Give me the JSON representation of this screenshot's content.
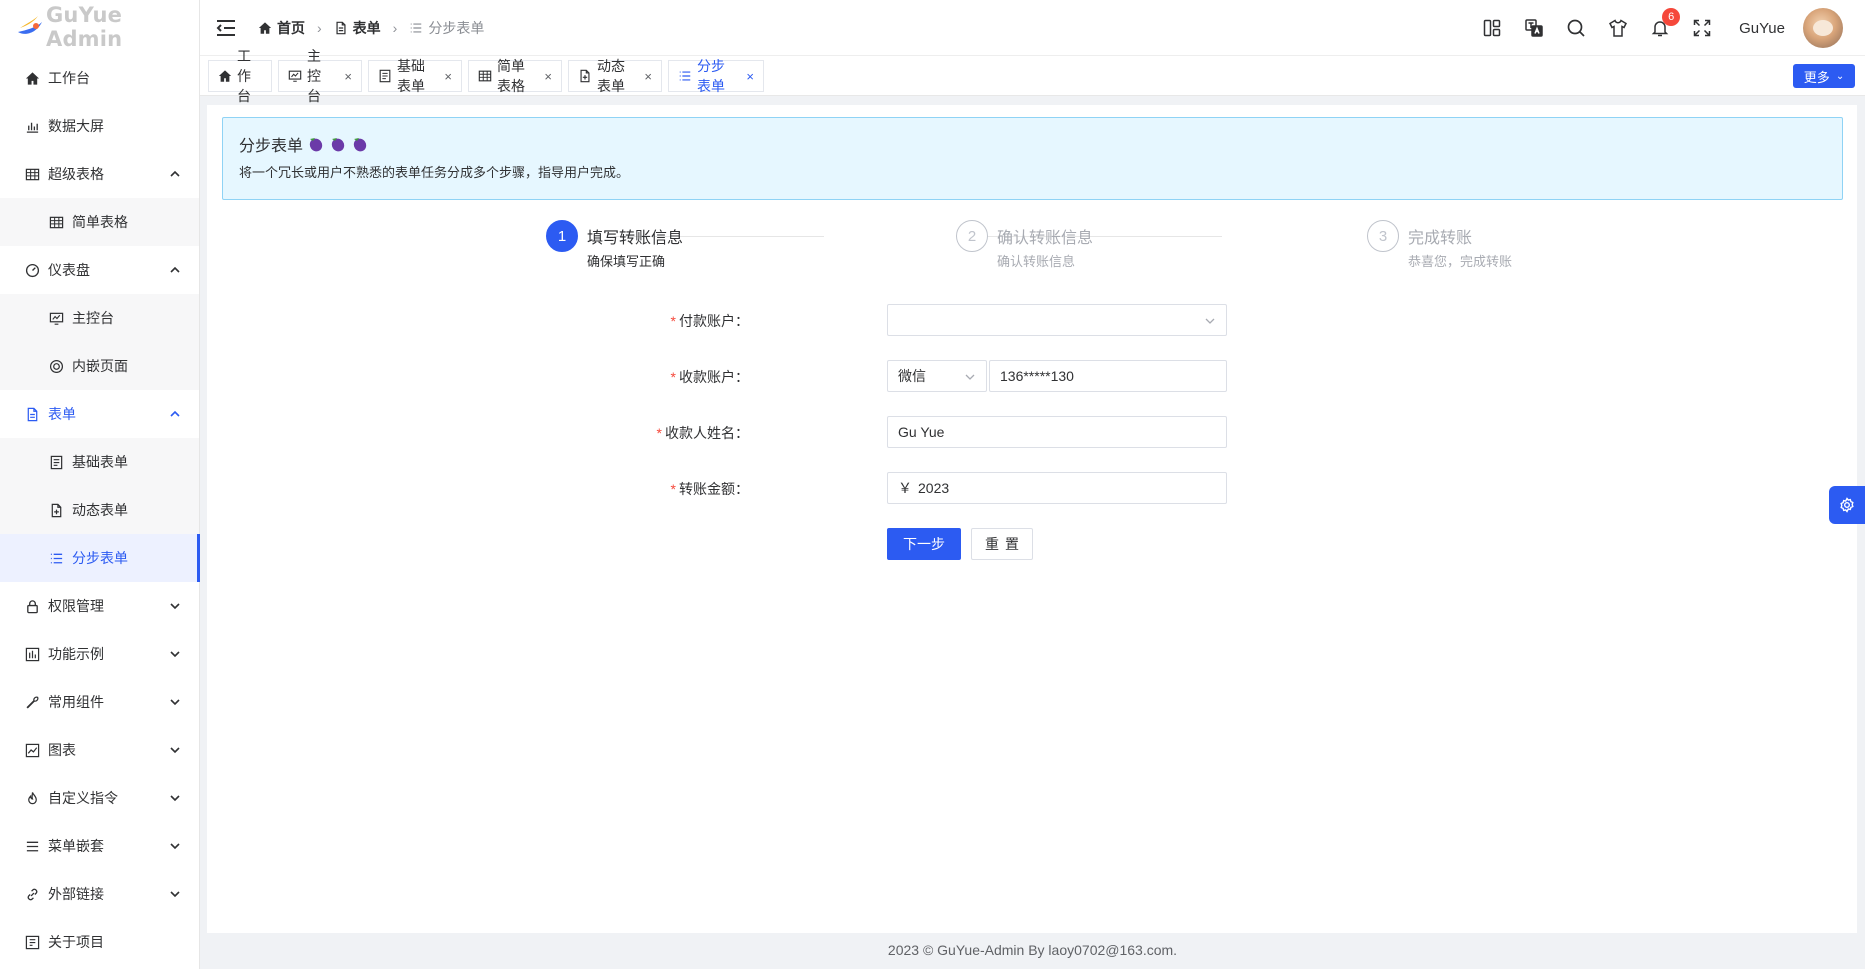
{
  "app": {
    "name": "GuYue Admin"
  },
  "sidebar": {
    "items": [
      {
        "label": "工作台",
        "icon": "home-icon",
        "level": 1
      },
      {
        "label": "数据大屏",
        "icon": "bar-chart-icon",
        "level": 1
      },
      {
        "label": "超级表格",
        "icon": "grid-icon",
        "level": 1,
        "expanded": true
      },
      {
        "label": "简单表格",
        "icon": "grid-icon",
        "level": 2
      },
      {
        "label": "仪表盘",
        "icon": "speedometer-icon",
        "level": 1,
        "expanded": true
      },
      {
        "label": "主控台",
        "icon": "monitor-icon",
        "level": 2
      },
      {
        "label": "内嵌页面",
        "icon": "target-icon",
        "level": 2
      },
      {
        "label": "表单",
        "icon": "document-icon",
        "level": 1,
        "expanded": true,
        "active": true
      },
      {
        "label": "基础表单",
        "icon": "form-icon",
        "level": 2
      },
      {
        "label": "动态表单",
        "icon": "document-plus-icon",
        "level": 2
      },
      {
        "label": "分步表单",
        "icon": "list-icon",
        "level": 2,
        "active": true
      },
      {
        "label": "权限管理",
        "icon": "lock-icon",
        "level": 1
      },
      {
        "label": "功能示例",
        "icon": "function-icon",
        "level": 1
      },
      {
        "label": "常用组件",
        "icon": "tool-icon",
        "level": 1
      },
      {
        "label": "图表",
        "icon": "line-chart-icon",
        "level": 1
      },
      {
        "label": "自定义指令",
        "icon": "fire-icon",
        "level": 1
      },
      {
        "label": "菜单嵌套",
        "icon": "menu-icon",
        "level": 1
      },
      {
        "label": "外部链接",
        "icon": "link-icon",
        "level": 1
      },
      {
        "label": "关于项目",
        "icon": "info-box-icon",
        "level": 1
      }
    ]
  },
  "header": {
    "breadcrumb": [
      {
        "label": "首页",
        "icon": "home-icon"
      },
      {
        "label": "表单",
        "icon": "document-icon"
      },
      {
        "label": "分步表单",
        "icon": "list-icon"
      }
    ],
    "notification_count": "6",
    "username": "GuYue"
  },
  "tabs": {
    "items": [
      {
        "label": "工作台",
        "icon": "home-icon",
        "closable": false
      },
      {
        "label": "主控台",
        "icon": "monitor-icon",
        "closable": true
      },
      {
        "label": "基础表单",
        "icon": "form-icon",
        "closable": true
      },
      {
        "label": "简单表格",
        "icon": "grid-icon",
        "closable": true
      },
      {
        "label": "动态表单",
        "icon": "document-plus-icon",
        "closable": true
      },
      {
        "label": "分步表单",
        "icon": "list-icon",
        "closable": true,
        "active": true
      }
    ],
    "more_label": "更多"
  },
  "alert": {
    "title": "分步表单",
    "description": "将一个冗长或用户不熟悉的表单任务分成多个步骤，指导用户完成。"
  },
  "steps": [
    {
      "number": "1",
      "title": "填写转账信息",
      "description": "确保填写正确",
      "status": "active"
    },
    {
      "number": "2",
      "title": "确认转账信息",
      "description": "确认转账信息",
      "status": "wait"
    },
    {
      "number": "3",
      "title": "完成转账",
      "description": "恭喜您，完成转账",
      "status": "wait"
    }
  ],
  "form": {
    "pay_account": {
      "label": "付款账户",
      "value": ""
    },
    "receive_account": {
      "label": "收款账户",
      "type": "微信",
      "value": "136*****130"
    },
    "receiver_name": {
      "label": "收款人姓名",
      "value": "Gu Yue"
    },
    "amount": {
      "label": "转账金额",
      "prefix": "￥",
      "value": "2023"
    },
    "next_label": "下一步",
    "reset_label": "重置"
  },
  "footer": {
    "text": "2023 © GuYue-Admin By laoy0702@163.com."
  },
  "colors": {
    "primary": "#2c5bf2",
    "danger": "#f5483b",
    "alert_bg": "#e6f7ff"
  }
}
